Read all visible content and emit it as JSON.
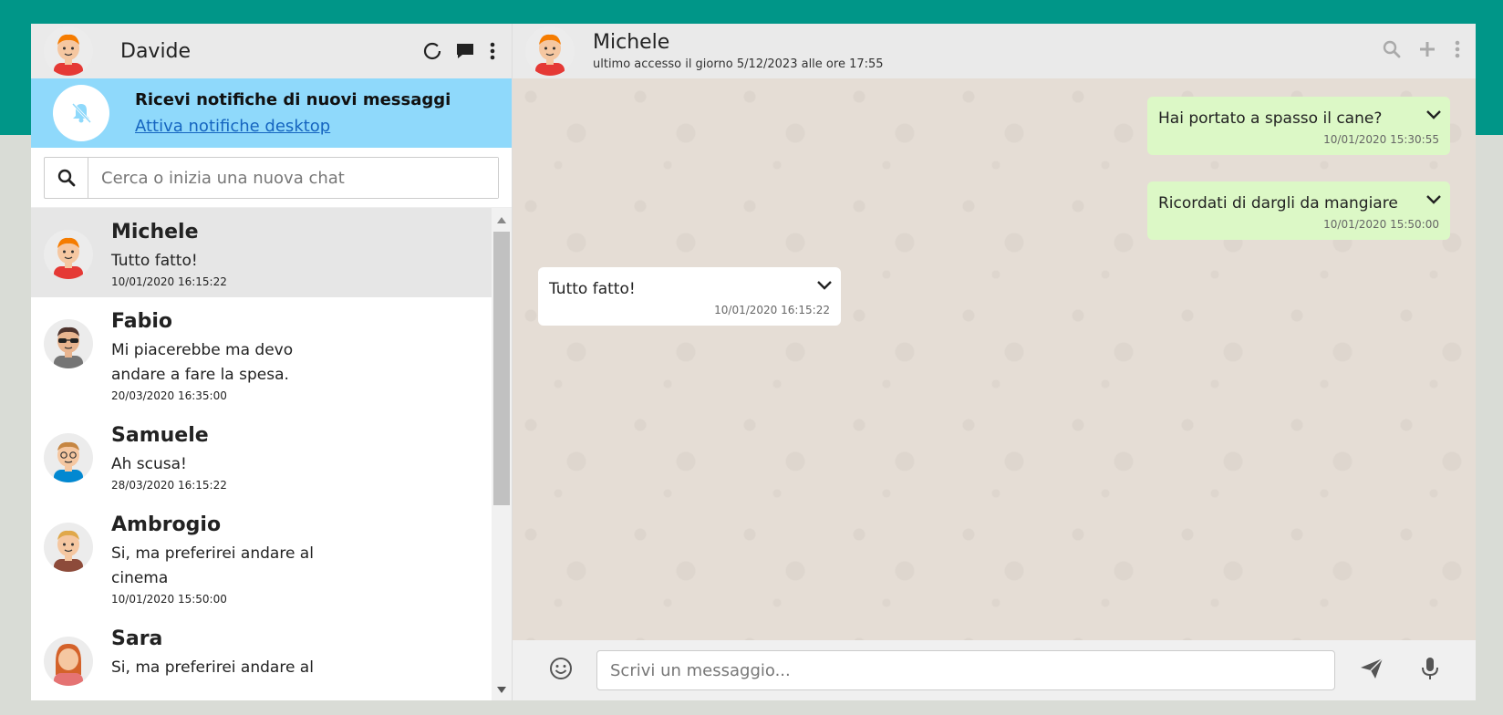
{
  "user": {
    "name": "Davide"
  },
  "notification": {
    "title": "Ricevi notifiche di nuovi messaggi",
    "link": "Attiva notifiche desktop"
  },
  "search": {
    "placeholder": "Cerca o inizia una nuova chat"
  },
  "contacts": [
    {
      "name": "Michele",
      "message": "Tutto fatto!",
      "time": "10/01/2020 16:15:22",
      "active": true,
      "avatar": "orange-hair-avatar"
    },
    {
      "name": "Fabio",
      "message": "Mi piacerebbe ma devo andare a fare la spesa.",
      "time": "20/03/2020 16:35:00",
      "avatar": "sunglasses-avatar"
    },
    {
      "name": "Samuele",
      "message": "Ah scusa!",
      "time": "28/03/2020 16:15:22",
      "avatar": "glasses-avatar"
    },
    {
      "name": "Ambrogio",
      "message": "Si, ma preferirei andare al cinema",
      "time": "10/01/2020 15:50:00",
      "avatar": "blond-avatar"
    },
    {
      "name": "Sara",
      "message": "Si, ma preferirei andare al",
      "time": "",
      "avatar": "female-avatar"
    }
  ],
  "chat": {
    "name": "Michele",
    "last_seen": "ultimo accesso il giorno 5/12/2023 alle ore 17:55",
    "messages": [
      {
        "type": "sent",
        "text": "Hai portato a spasso il cane?",
        "time": "10/01/2020 15:30:55"
      },
      {
        "type": "sent",
        "text": "Ricordati di dargli da mangiare",
        "time": "10/01/2020 15:50:00"
      },
      {
        "type": "received",
        "text": "Tutto fatto!",
        "time": "10/01/2020 16:15:22"
      }
    ]
  },
  "composer": {
    "placeholder": "Scrivi un messaggio..."
  },
  "colors": {
    "accent": "#009688",
    "sent_bubble": "#dcf8c6",
    "notification_bar": "#8fd9fb",
    "chat_bg": "#e5ddd5"
  }
}
